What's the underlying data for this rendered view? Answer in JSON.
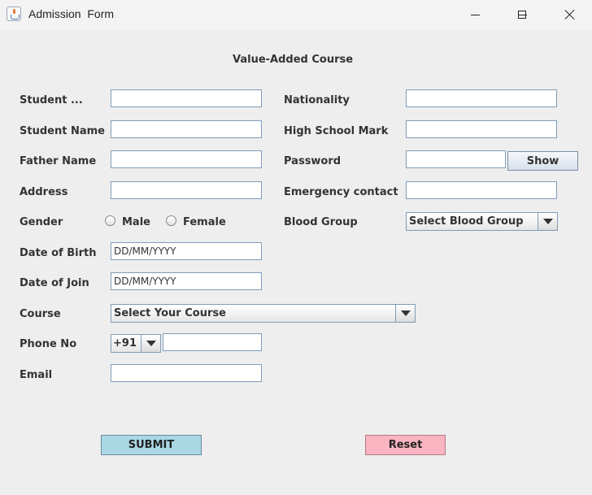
{
  "window": {
    "title": "Admission  Form",
    "controls": {
      "minimize": "minimize-icon",
      "maximize": "maximize-icon",
      "close": "close-icon"
    }
  },
  "form": {
    "heading": "Value-Added Course",
    "left": {
      "student_id_label": "Student ...",
      "student_name_label": "Student Name",
      "father_name_label": "Father Name",
      "address_label": "Address",
      "gender_label": "Gender",
      "gender_options": [
        "Male",
        "Female"
      ],
      "dob_label": "Date of Birth",
      "dob_value": "DD/MM/YYYY",
      "doj_label": "Date of Join",
      "doj_value": "DD/MM/YYYY",
      "course_label": "Course",
      "course_selected": "Select Your Course",
      "phone_label": "Phone No",
      "phone_code": "+91",
      "email_label": "Email"
    },
    "right": {
      "nationality_label": "Nationality",
      "high_school_label": "High School Mark",
      "password_label": "Password",
      "show_button": "Show",
      "emergency_label": "Emergency contact",
      "blood_group_label": "Blood Group",
      "blood_group_selected": "Select Blood Group"
    },
    "buttons": {
      "submit": "SUBMIT",
      "reset": "Reset",
      "submit_color": "#a9d7e3",
      "reset_color": "#fbb4c1"
    }
  }
}
